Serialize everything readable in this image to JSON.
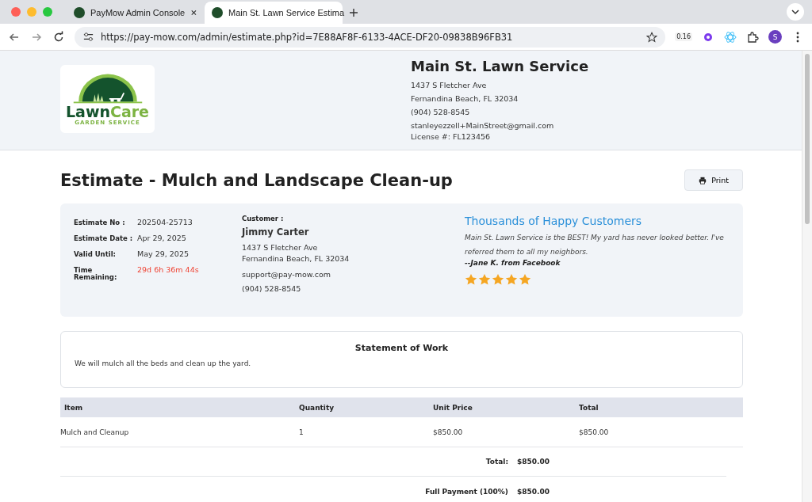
{
  "browser": {
    "tabs": [
      {
        "title": "PayMow Admin Console",
        "selected": false
      },
      {
        "title": "Main St. Lawn Service Estima",
        "selected": true
      }
    ],
    "url": "https://pay-mow.com/admin/estimate.php?id=7E88AF8F-6133-4ACE-DF20-09838B96FB31",
    "extension_badge": "0.16",
    "profile_initial": "S"
  },
  "logo": {
    "word_dark": "Lawn",
    "word_light": "Care",
    "tagline": "GARDEN SERVICE"
  },
  "company": {
    "name": "Main St. Lawn Service",
    "lines": [
      "1437 S Fletcher Ave",
      "Fernandina Beach, FL 32034",
      "(904) 528-8545",
      "stanleyezzell+MainStreet@gmail.com"
    ],
    "license": "License #: FL123456"
  },
  "title": "Estimate - Mulch and Landscape Clean-up",
  "print_button": "Print",
  "details": [
    {
      "label": "Estimate No :",
      "value": "202504-25713",
      "alert": false
    },
    {
      "label": "Estimate Date :",
      "value": "Apr 29, 2025",
      "alert": false
    },
    {
      "label": "Valid Until:",
      "value": "May 29, 2025",
      "alert": false
    },
    {
      "label": "Time Remaining:",
      "value": "29d 6h 36m 44s",
      "alert": true
    }
  ],
  "customer": {
    "label": "Customer :",
    "name": "Jimmy Carter",
    "address": [
      "1437 S Fletcher Ave",
      "Fernandina Beach, FL 32034"
    ],
    "email": "support@pay-mow.com",
    "phone": "(904) 528-8545"
  },
  "testimonial": {
    "heading": "Thousands of Happy Customers",
    "quote": "Main St. Lawn Service is the BEST! My yard has never looked better. I've referred them to all my neighbors.",
    "author": "--Jane K. from Facebook",
    "stars": 5
  },
  "statement": {
    "title": "Statement of Work",
    "text": "We will mulch all the beds and clean up the yard."
  },
  "table": {
    "columns": [
      "Item",
      "Quantity",
      "Unit Price",
      "Total"
    ],
    "rows": [
      [
        "Mulch and Cleanup",
        "1",
        "$850.00",
        "$850.00"
      ]
    ],
    "summary": [
      {
        "label": "Total:",
        "value": "$850.00"
      },
      {
        "label": "Full Payment (100%)",
        "value": "$850.00"
      }
    ]
  }
}
